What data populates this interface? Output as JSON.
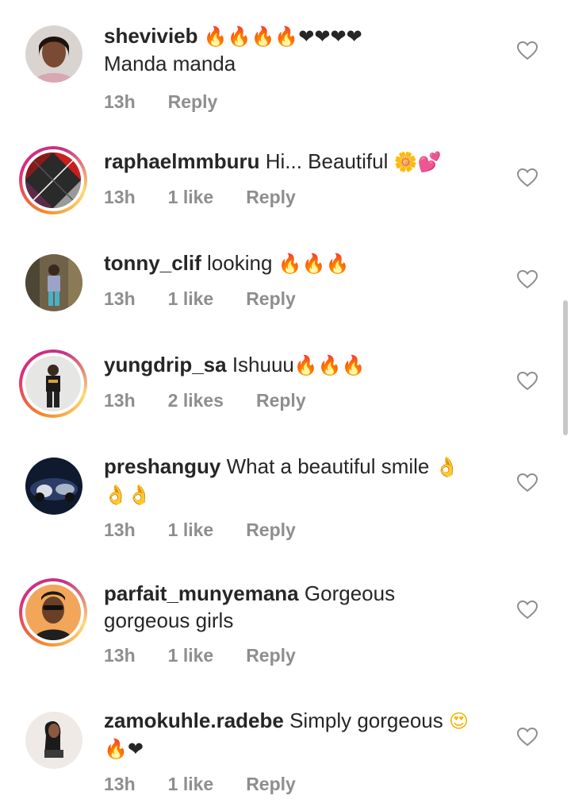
{
  "comments": [
    {
      "username": "shevivieb",
      "text": "",
      "emoji": "🔥🔥🔥🔥❤❤❤❤",
      "text2": "Manda manda",
      "time": "13h",
      "likes": "",
      "reply": "Reply",
      "story": false
    },
    {
      "username": "raphaelmmburu",
      "text": "Hi... Beautiful",
      "emoji": "🌼💕",
      "time": "13h",
      "likes": "1 like",
      "reply": "Reply",
      "story": true
    },
    {
      "username": "tonny_clif",
      "text": "looking",
      "emoji": "🔥🔥🔥",
      "time": "13h",
      "likes": "1 like",
      "reply": "Reply",
      "story": false
    },
    {
      "username": "yungdrip_sa",
      "text": "Ishuuu",
      "emoji": "🔥🔥🔥",
      "time": "13h",
      "likes": "2 likes",
      "reply": "Reply",
      "story": true
    },
    {
      "username": "preshanguy",
      "text": "What a beautiful smile",
      "emoji": "👌",
      "emoji2": "👌👌",
      "time": "13h",
      "likes": "1 like",
      "reply": "Reply",
      "story": false
    },
    {
      "username": "parfait_munyemana",
      "text": "Gorgeous",
      "text2": "gorgeous girls",
      "time": "13h",
      "likes": "1 like",
      "reply": "Reply",
      "story": true
    },
    {
      "username": "zamokuhle.radebe",
      "text": "Simply gorgeous",
      "emoji": "😍",
      "emoji2": "🔥❤",
      "time": "13h",
      "likes": "1 like",
      "reply": "Reply",
      "story": false
    }
  ]
}
